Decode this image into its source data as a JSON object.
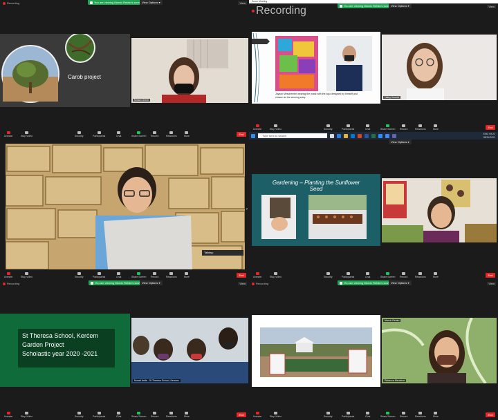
{
  "common": {
    "recording_label": "Recording",
    "viewing_label": "You are viewing Marvic Refalo's screen",
    "view_options_label": "View Options",
    "view_label": "View",
    "end_label": "End"
  },
  "toolbar_items": [
    {
      "label": "Unmute",
      "icon": "mic-icon"
    },
    {
      "label": "Stop Video",
      "icon": "video-icon"
    },
    {
      "label": "Security",
      "icon": "shield-icon"
    },
    {
      "label": "Participants",
      "icon": "participants-icon"
    },
    {
      "label": "Chat",
      "icon": "chat-icon"
    },
    {
      "label": "Share Screen",
      "icon": "share-icon"
    },
    {
      "label": "Record",
      "icon": "record-icon"
    },
    {
      "label": "Reactions",
      "icon": "reactions-icon"
    },
    {
      "label": "More",
      "icon": "more-icon"
    }
  ],
  "panel1": {
    "slide_title": "Carob project",
    "participant_name": "Miriam Grech"
  },
  "panel2": {
    "window_title": "Zoom Meeting",
    "caption_line1": "Jayson Meschembri wearing the mask with the logo designed by himself and",
    "caption_line2": "chosen as the winning entry.",
    "participant_name": "Haley Xuereb"
  },
  "panel3": {
    "talking_label": "Talking:"
  },
  "panel4": {
    "slide_title_line1": "Gardening – Planting the Sunflower",
    "slide_title_line2": "Seed",
    "taskbar_search": "Type here to search",
    "tray_line1": "09:21",
    "tray_line2": "08/11/2021",
    "tray_lang": "ENG"
  },
  "panel5": {
    "slide_line1": "St Theresa School, Kerċem",
    "slide_line2": "Garden Project",
    "slide_line3": "Scholastic year 2020 -2021",
    "participant_name": "Murad Anita - St Theresa School, Kercem"
  },
  "panel6": {
    "thumb_label": "Marvic Refalo",
    "participant_name": "Rebecca Mercieca"
  },
  "colors": {
    "zoom_bg": "#1b1b1b",
    "viewing_green": "#23a455",
    "end_red": "#e02828",
    "slide_green": "#0f6b3a",
    "slide_teal": "#1d5f66"
  }
}
